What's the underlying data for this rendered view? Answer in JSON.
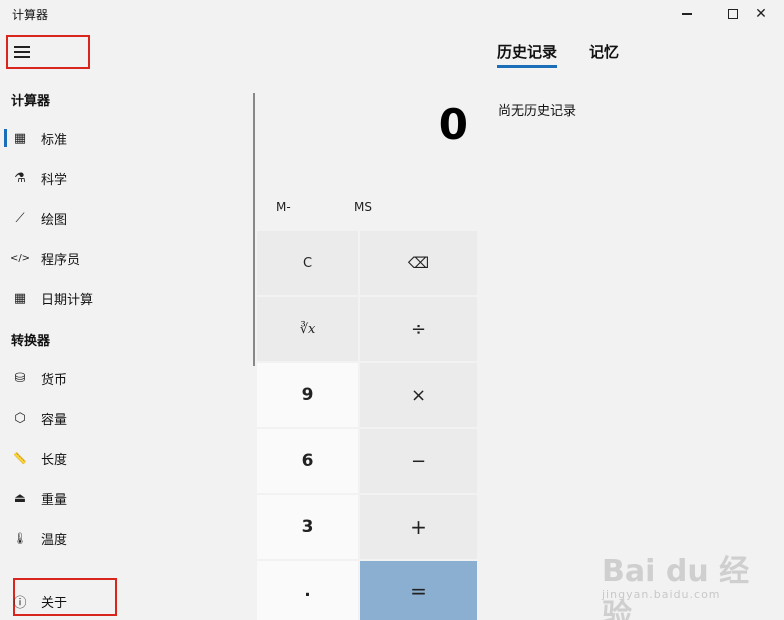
{
  "window": {
    "title": "计算器",
    "min_icon": "minimize-icon",
    "max_icon": "maximize-icon",
    "close_icon": "close-icon",
    "close_glyph": "✕"
  },
  "nav": {
    "menu_icon": "hamburger-menu-icon",
    "section_calculators": "计算器",
    "calculators": [
      {
        "label": "标准",
        "icon": "calculator-icon",
        "glyph": "▦",
        "active": true
      },
      {
        "label": "科学",
        "icon": "flask-icon",
        "glyph": "⚗"
      },
      {
        "label": "绘图",
        "icon": "graph-icon",
        "glyph": "⟋"
      },
      {
        "label": "程序员",
        "icon": "code-icon",
        "glyph": "</>"
      },
      {
        "label": "日期计算",
        "icon": "calendar-icon",
        "glyph": "▦"
      }
    ],
    "section_converters": "转换器",
    "converters": [
      {
        "label": "货币",
        "icon": "currency-icon",
        "glyph": "⛁"
      },
      {
        "label": "容量",
        "icon": "cube-icon",
        "glyph": "⬡"
      },
      {
        "label": "长度",
        "icon": "ruler-icon",
        "glyph": "📏"
      },
      {
        "label": "重量",
        "icon": "weight-icon",
        "glyph": "⏏"
      },
      {
        "label": "温度",
        "icon": "thermometer-icon",
        "glyph": "🌡"
      }
    ],
    "about": {
      "label": "关于",
      "icon": "info-icon",
      "glyph": "ⓘ"
    }
  },
  "display": {
    "value": "0"
  },
  "memory": {
    "minus": "M-",
    "store": "MS"
  },
  "keys": {
    "clear": "C",
    "backspace_glyph": "⌫",
    "cube_root": "∛x",
    "divide": "÷",
    "nine": "9",
    "multiply": "×",
    "six": "6",
    "minus": "−",
    "three": "3",
    "plus": "+",
    "decimal": ".",
    "equals": "="
  },
  "history": {
    "tab_history": "历史记录",
    "tab_memory": "记忆",
    "empty_text": "尚无历史记录"
  },
  "watermark": {
    "logo": "Bai du 经验",
    "sub": "jingyan.baidu.com"
  },
  "colors": {
    "accent": "#1a6fb8",
    "equals_key": "#8aafd0",
    "highlight_box": "#d9261c"
  }
}
